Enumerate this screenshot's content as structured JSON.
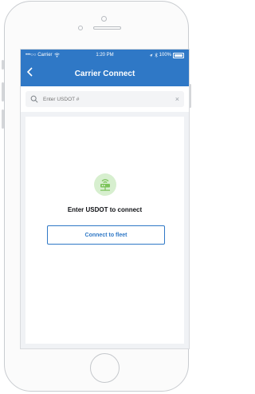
{
  "status_bar": {
    "carrier": "•••○○ Carrier",
    "time": "1:20 PM",
    "battery": "100%"
  },
  "nav": {
    "back_label": "<",
    "title": "Carrier Connect"
  },
  "search": {
    "placeholder": "Enter USDOT #",
    "clear_label": "×"
  },
  "empty_state": {
    "headline": "Enter USDOT to connect",
    "button_label": "Connect to fleet"
  },
  "colors": {
    "brand_blue": "#2f78c6",
    "illustration_green": "#7cc35a",
    "illustration_bg": "#d7efcf"
  },
  "icons": {
    "back": "chevron-left-icon",
    "search": "search-icon",
    "clear": "close-icon",
    "empty_state": "wifi-router-icon"
  }
}
